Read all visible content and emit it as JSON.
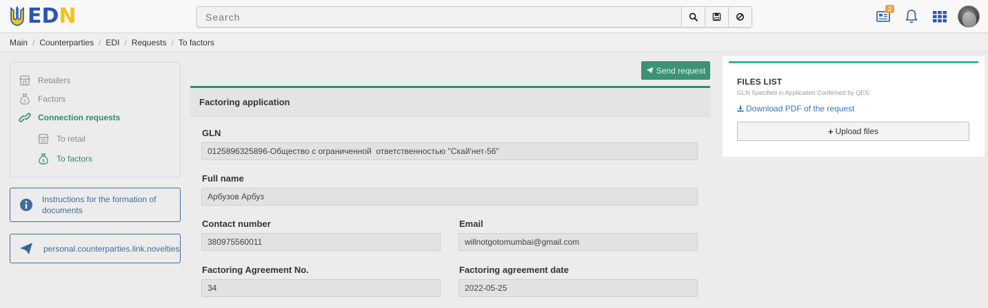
{
  "header": {
    "logo_text": {
      "e": "E",
      "d": "D",
      "n": "N"
    },
    "search": {
      "placeholder": "Search",
      "value": ""
    },
    "search_buttons": [
      "search-icon",
      "save-icon",
      "ban-icon"
    ],
    "notifications_badge": "2",
    "icons": [
      "news-icon",
      "bell-icon",
      "apps-grid-icon",
      "avatar"
    ]
  },
  "breadcrumb": [
    "Main",
    "Counterparties",
    "EDI",
    "Requests",
    "To factors"
  ],
  "sidebar": {
    "items": [
      {
        "label": "Retailers",
        "icon": "store-icon",
        "active": false
      },
      {
        "label": "Factors",
        "icon": "money-bag-icon",
        "active": false
      },
      {
        "label": "Connection requests",
        "icon": "link-icon",
        "active": true
      },
      {
        "label": "To retail",
        "icon": "store-icon",
        "active": false
      },
      {
        "label": "To factors",
        "icon": "money-bag-icon",
        "active": true
      }
    ],
    "cards": [
      {
        "label": "Instructions for the formation of documents",
        "icon": "info-icon"
      },
      {
        "label": "personal.counterparties.link.novelties",
        "icon": "paper-plane-icon"
      }
    ]
  },
  "main": {
    "send_button": "Send request",
    "form_title": "Factoring application",
    "fields": {
      "gln": {
        "label": "GLN",
        "value": "0125896325896-Общество с ограниченной  ответственностью \"Скай'нет-56\""
      },
      "full_name": {
        "label": "Full name",
        "value": "Арбузов Арбуз"
      },
      "contact_number": {
        "label": "Contact number",
        "value": "380975560011"
      },
      "email": {
        "label": "Email",
        "value": "willnotgotomumbai@gmail.com"
      },
      "agreement_no": {
        "label": "Factoring Agreement No.",
        "value": "34"
      },
      "agreement_date": {
        "label": "Factoring agreement date",
        "value": "2022-05-25"
      }
    }
  },
  "files": {
    "title": "FILES LIST",
    "subtitle": "GLN Specified in Application Confirmed by QES:",
    "download_link": "Download PDF of the request",
    "upload_button": "Upload files"
  },
  "colors": {
    "accent_green": "#2e8b6e",
    "files_accent": "#2bb89a",
    "link_blue": "#3877b8",
    "logo_blue": "#2a57a8",
    "logo_yellow": "#f2c318",
    "badge_orange": "#e8a44a"
  }
}
